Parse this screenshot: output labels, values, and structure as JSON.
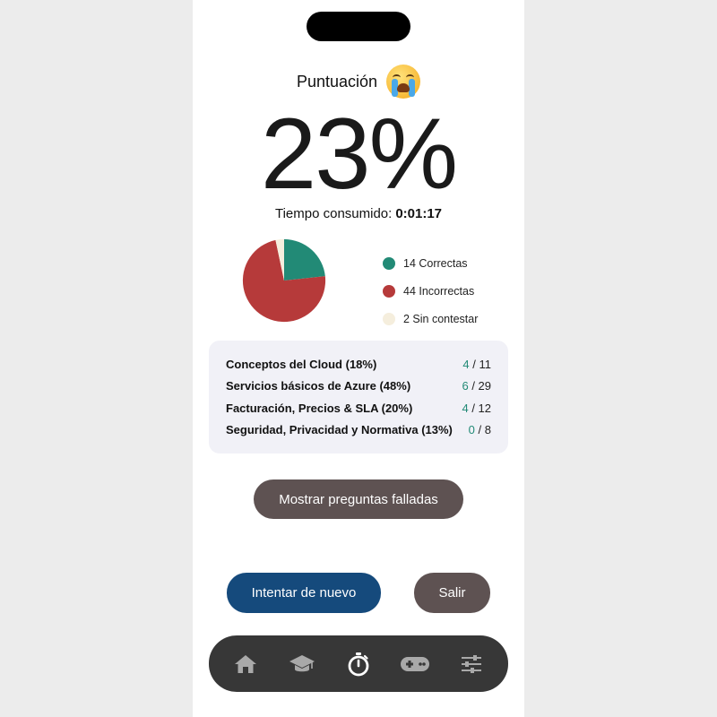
{
  "score": {
    "title": "Puntuación",
    "emoji": "loudly-crying-face",
    "percent": "23%",
    "time_label": "Tiempo consumido:",
    "time_value": "0:01:17"
  },
  "chart_data": {
    "type": "pie",
    "slices": [
      {
        "name": "Correctas",
        "value": 14,
        "color": "#228a76"
      },
      {
        "name": "Incorrectas",
        "value": 44,
        "color": "#b63a3a"
      },
      {
        "name": "Sin contestar",
        "value": 2,
        "color": "#f5eedd"
      }
    ]
  },
  "legend": [
    {
      "label": "14 Correctas",
      "color": "#228a76"
    },
    {
      "label": "44 Incorrectas",
      "color": "#b63a3a"
    },
    {
      "label": "2 Sin contestar",
      "color": "#f5eedd"
    }
  ],
  "breakdown": [
    {
      "label": "Conceptos del Cloud (18%)",
      "correct": "4",
      "total": "/ 11"
    },
    {
      "label": "Servicios básicos de Azure (48%)",
      "correct": "6",
      "total": "/ 29"
    },
    {
      "label": "Facturación, Precios & SLA (20%)",
      "correct": "4",
      "total": "/ 12"
    },
    {
      "label": "Seguridad, Privacidad y Normativa (13%)",
      "correct": "0",
      "total": "/ 8"
    }
  ],
  "buttons": {
    "show_failed": "Mostrar preguntas falladas",
    "retry": "Intentar de nuevo",
    "exit": "Salir"
  },
  "tabbar": {
    "items": [
      {
        "icon": "home-icon",
        "active": false
      },
      {
        "icon": "graduation-cap-icon",
        "active": false
      },
      {
        "icon": "stopwatch-icon",
        "active": true
      },
      {
        "icon": "gamepad-icon",
        "active": false
      },
      {
        "icon": "sliders-icon",
        "active": false
      }
    ]
  },
  "colors": {
    "accent_correct": "#228a76",
    "incorrect": "#b63a3a",
    "unanswered": "#f5eedd",
    "primary_button": "#154a7c",
    "secondary_button": "#5e5252",
    "tabbar_bg": "#373737"
  }
}
